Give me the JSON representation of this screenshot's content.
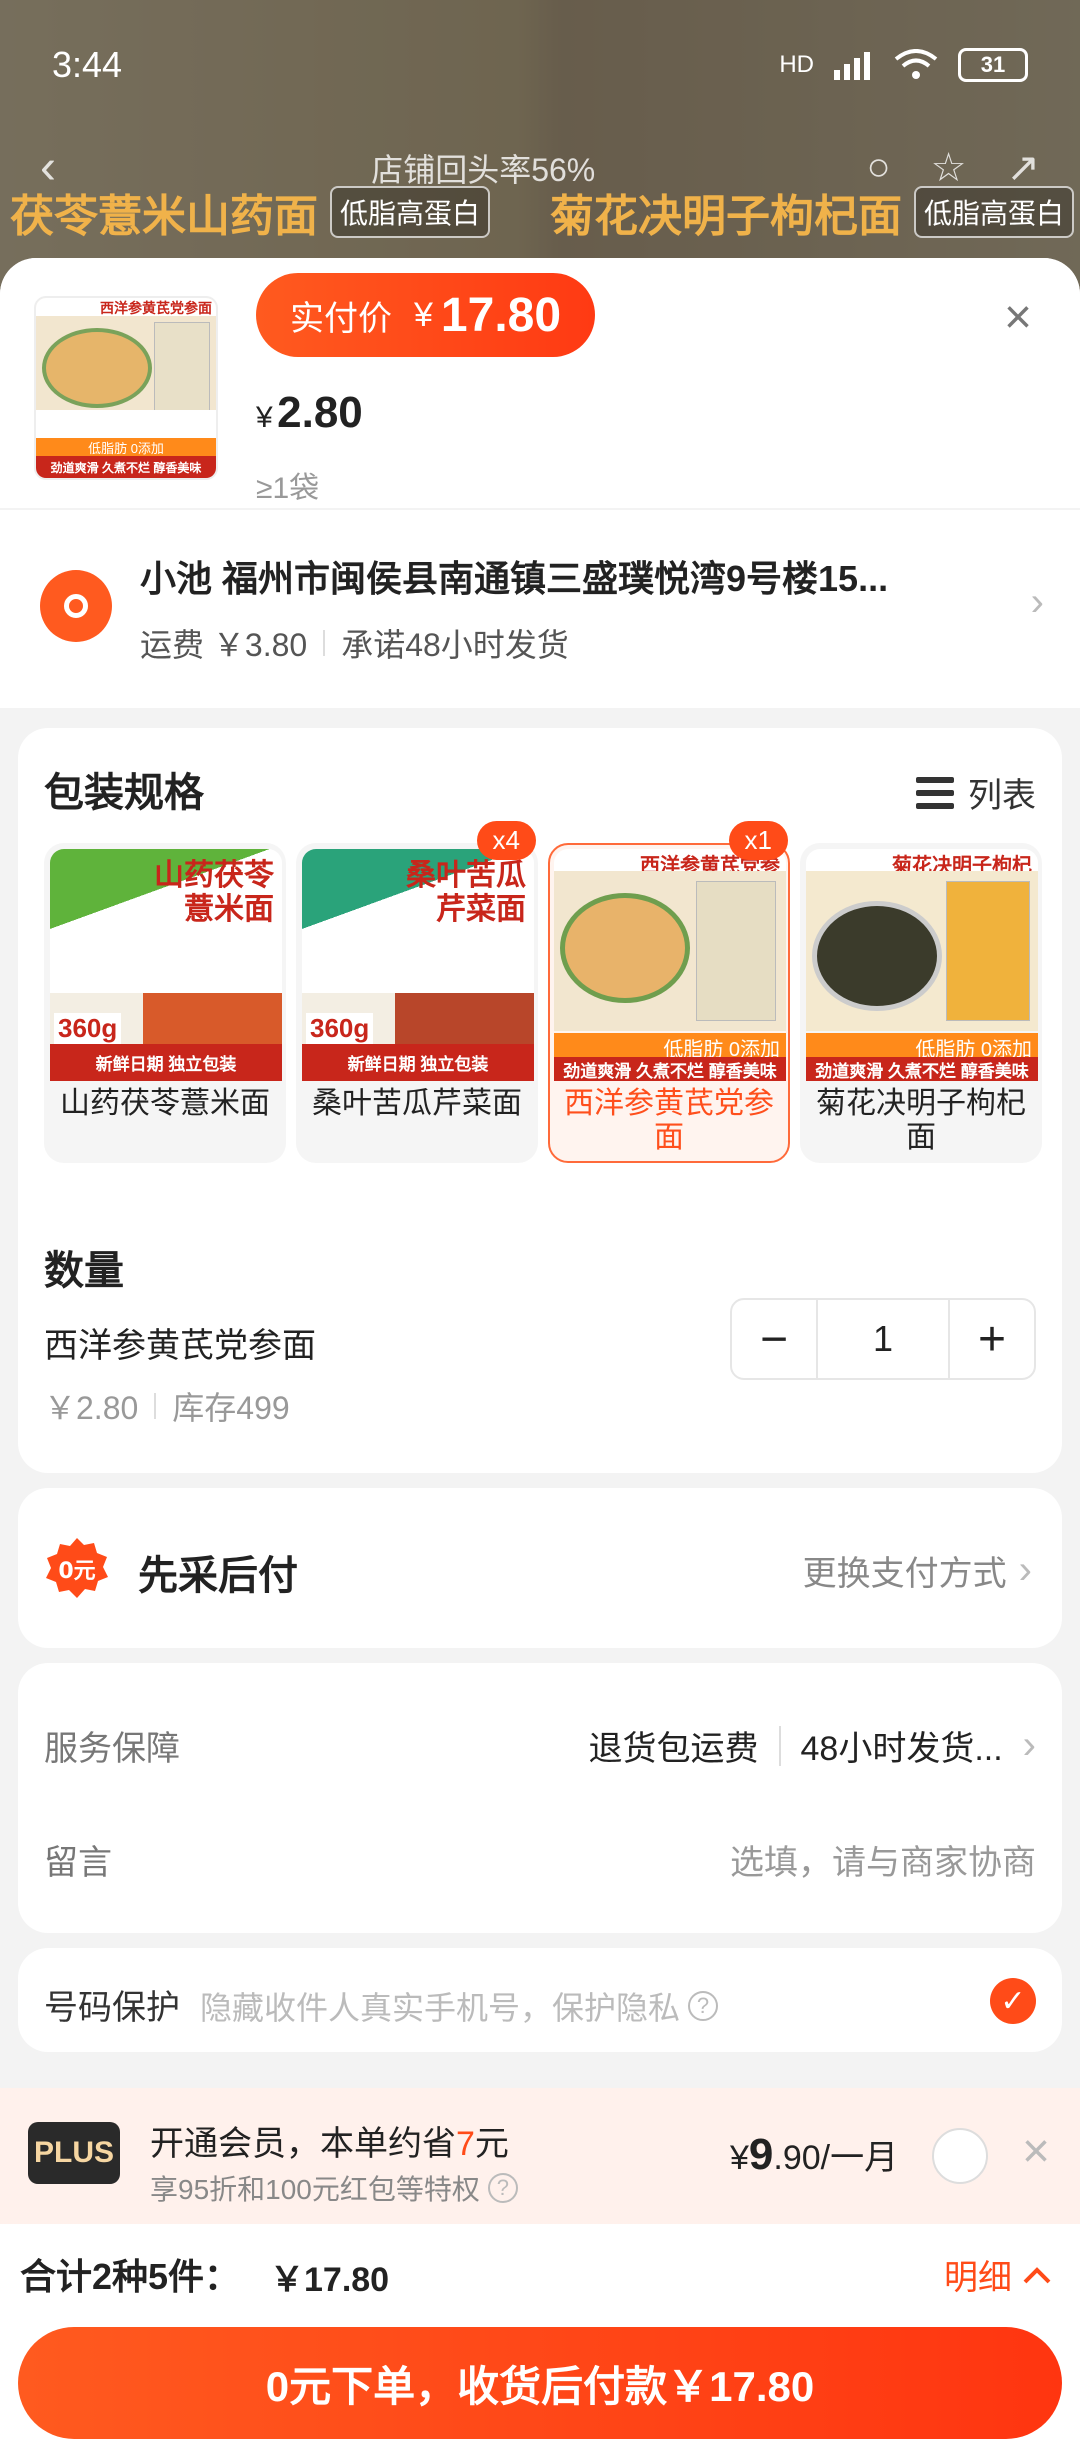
{
  "status_bar": {
    "time": "3:44",
    "net": "HD",
    "battery": "31"
  },
  "background": {
    "return_rate": "店铺回头率56%",
    "banner_left_title": "茯苓薏米山药面",
    "banner_left_tag": "低脂高蛋白",
    "banner_right_title": "菊花决明子枸杞面",
    "banner_right_tag": "低脂高蛋白"
  },
  "header": {
    "pay_label": "实付价",
    "currency": "¥",
    "pay_amount": "17.80",
    "unit_price": "2.80",
    "min_qty": "≥1袋",
    "thumb_title": "西洋参黄芪党参面",
    "thumb_tags": [
      "低脂肪 0添加",
      "劲道爽滑 久煮不烂 醇香美味"
    ]
  },
  "address": {
    "line": "小池 福州市闽侯县南通镇三盛璞悦湾9号楼15...",
    "shipping": "运费 ￥3.80",
    "promise": "承诺48小时发货"
  },
  "spec": {
    "title": "包装规格",
    "list_label": "列表",
    "options": [
      {
        "name": "山药茯苓薏米面",
        "img_title": "山药茯苓\n薏米面",
        "net": "360g",
        "strip": "新鲜日期 独立包装",
        "badge": "",
        "selected": false
      },
      {
        "name": "桑叶苦瓜芹菜面",
        "img_title": "桑叶苦瓜\n芹菜面",
        "net": "360g",
        "strip": "新鲜日期 独立包装",
        "badge": "x4",
        "selected": false
      },
      {
        "name": "西洋参黄芪党参面",
        "img_title": "西洋参黄芪党参",
        "net": "",
        "strip": "劲道爽滑 久煮不烂 醇香美味",
        "badge": "x1",
        "selected": true
      },
      {
        "name": "菊花决明子枸杞面",
        "img_title": "菊花决明子枸杞",
        "net": "",
        "strip": "劲道爽滑 久煮不烂 醇香美味",
        "badge": "",
        "selected": false
      }
    ]
  },
  "quantity": {
    "title": "数量",
    "item_name": "西洋参黄芪党参面",
    "price": "￥2.80",
    "stock": "库存499",
    "value": "1",
    "minus": "−",
    "plus": "+"
  },
  "payment": {
    "label": "先采后付",
    "change": "更换支付方式",
    "icon_text": "0元"
  },
  "service": {
    "label": "服务保障",
    "item1": "退货包运费",
    "item2": "48小时发货...",
    "msg_label": "留言",
    "msg_placeholder": "选填，请与商家协商"
  },
  "number_protect": {
    "label": "号码保护",
    "desc": "隐藏收件人真实手机号，保护隐私",
    "checked": true
  },
  "plus": {
    "logo": "PLUS",
    "title_pre": "开通会员，本单约省",
    "title_hl": "7",
    "title_post": "元",
    "sub": "享95折和100元红包等特权",
    "price_cur": "¥",
    "price_big": "9",
    "price_small": ".90/一月"
  },
  "total": {
    "label": "合计2种5件：",
    "amount": "￥17.80",
    "detail": "明细"
  },
  "submit": {
    "label": "0元下单，收货后付款￥17.80"
  },
  "colors": {
    "accent": "#ff4b18",
    "accent2": "#ff5a1f"
  }
}
